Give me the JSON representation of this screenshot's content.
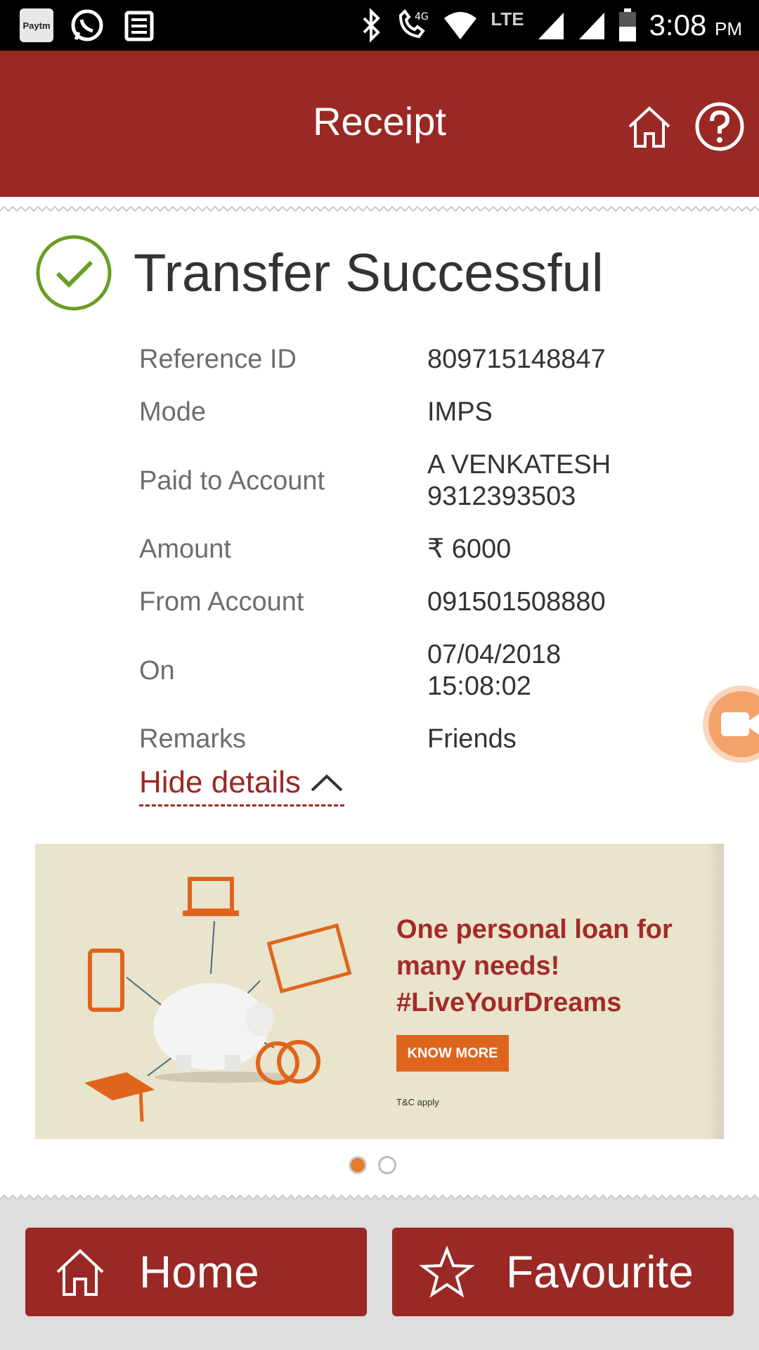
{
  "status_bar": {
    "paytm_label": "Paytm",
    "time": "3:08",
    "ampm": "PM",
    "network_4g": "4G",
    "network_lte": "LTE"
  },
  "header": {
    "title": "Receipt",
    "icons": [
      "home-icon",
      "help-icon"
    ]
  },
  "result": {
    "title": "Transfer Successful",
    "icon": "check-circle-icon",
    "color": "#6a9e24"
  },
  "details": [
    {
      "label": "Reference ID",
      "value": "809715148847"
    },
    {
      "label": "Mode",
      "value": "IMPS"
    },
    {
      "label": "Paid to Account",
      "value": "A VENKATESH",
      "value2": "9312393503"
    },
    {
      "label": "Amount",
      "value": "₹ 6000"
    },
    {
      "label": "From Account",
      "value": "091501508880"
    },
    {
      "label": "On",
      "value": "07/04/2018",
      "value2": "15:08:02"
    },
    {
      "label": "Remarks",
      "value": "Friends"
    }
  ],
  "hide_details_label": "Hide details",
  "banner": {
    "headline_1": "One personal loan for",
    "headline_2": "many needs!",
    "headline_3": "#LiveYourDreams",
    "cta": "KNOW MORE",
    "terms": "T&C apply",
    "active_slide": 1,
    "slide_count": 2
  },
  "footer": {
    "home_label": "Home",
    "favourite_label": "Favourite"
  },
  "colors": {
    "brand": "#9a2824",
    "accent": "#e5792e",
    "success": "#6a9e24"
  }
}
